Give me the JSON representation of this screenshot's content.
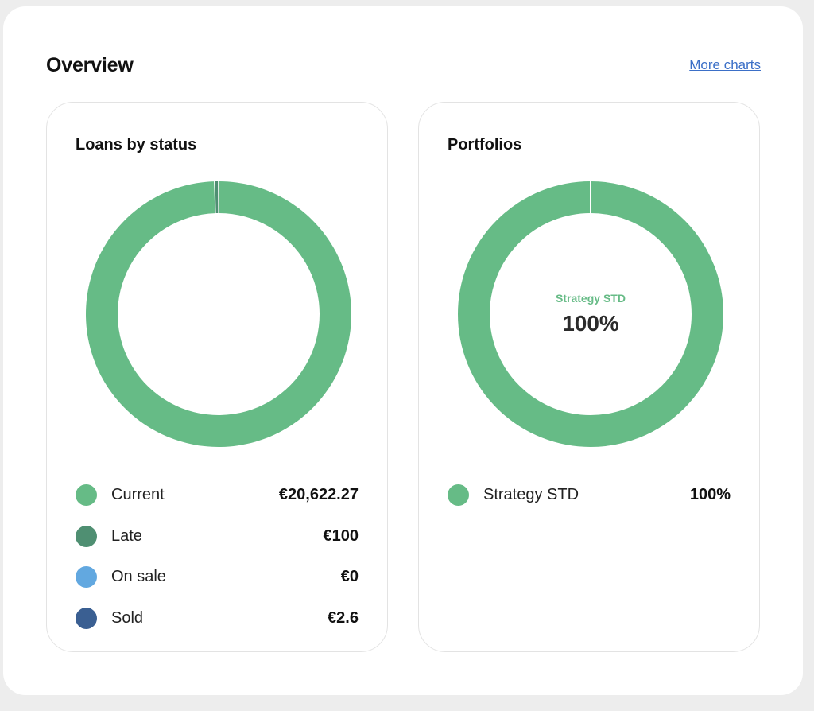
{
  "header": {
    "title": "Overview",
    "more_link": "More charts"
  },
  "loans_card": {
    "title": "Loans by status",
    "legend": [
      {
        "label": "Current",
        "value": "€20,622.27",
        "color": "#66bb86"
      },
      {
        "label": "Late",
        "value": "€100",
        "color": "#4f8f72"
      },
      {
        "label": "On sale",
        "value": "€0",
        "color": "#62a8e0"
      },
      {
        "label": "Sold",
        "value": "€2.6",
        "color": "#3a5f92"
      }
    ]
  },
  "portfolios_card": {
    "title": "Portfolios",
    "center_name": "Strategy STD",
    "center_value": "100%",
    "legend": [
      {
        "label": "Strategy STD",
        "value": "100%",
        "color": "#66bb86"
      }
    ]
  },
  "chart_data": [
    {
      "type": "pie",
      "title": "Loans by status",
      "categories": [
        "Current",
        "Late",
        "On sale",
        "Sold"
      ],
      "values": [
        20622.27,
        100,
        0,
        2.6
      ],
      "colors": [
        "#66bb86",
        "#4f8f72",
        "#62a8e0",
        "#3a5f92"
      ]
    },
    {
      "type": "pie",
      "title": "Portfolios",
      "categories": [
        "Strategy STD"
      ],
      "values": [
        100
      ],
      "colors": [
        "#66bb86"
      ]
    }
  ]
}
